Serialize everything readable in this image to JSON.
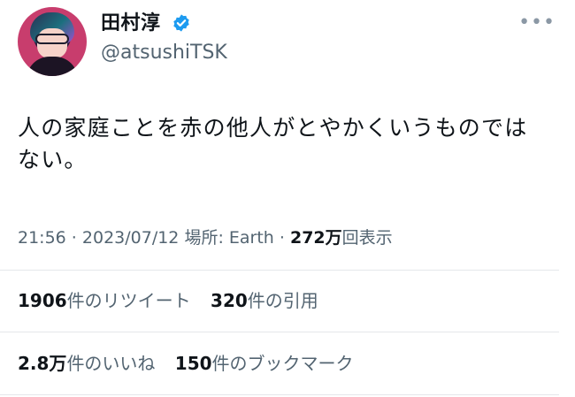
{
  "user": {
    "display_name": "田村淳",
    "handle": "@atsushiTSK",
    "verified": true,
    "verified_color": "#1d9bf0"
  },
  "tweet": {
    "text_line1": "人の家庭ことを赤の他人がとやかくいうものでは",
    "text_line2": "ない。"
  },
  "meta": {
    "time": "21:56",
    "separator1": " · ",
    "date": "2023/07/12",
    "location_label": " 場所: Earth",
    "separator2": " · ",
    "views_count": "272万",
    "views_label": "回表示"
  },
  "stats": {
    "retweets_count": "1906",
    "retweets_label": "件のリツイート",
    "quotes_count": "320",
    "quotes_label": "件の引用",
    "likes_count": "2.8万",
    "likes_label": "件のいいね",
    "bookmarks_count": "150",
    "bookmarks_label": "件のブックマーク"
  },
  "icons": {
    "more": "more-horizontal-icon",
    "verified": "verified-badge-icon"
  }
}
